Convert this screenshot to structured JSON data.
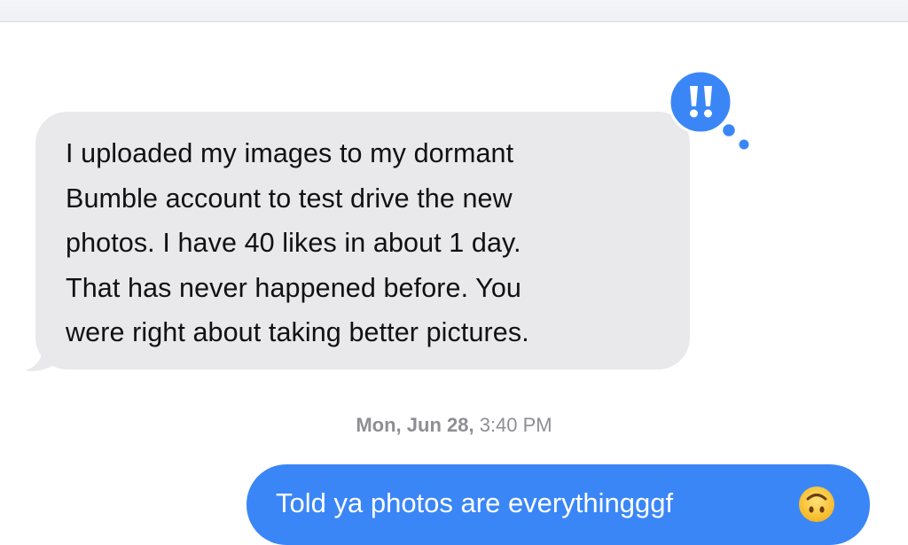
{
  "conversation": {
    "received_message": {
      "lines": [
        "I uploaded my images to my dormant",
        "Bumble account to test drive the new",
        "photos. I have 40 likes in about 1 day.",
        "That has never happened before. You",
        "were right about taking better pictures."
      ],
      "reaction": "exclamation-tapback-icon"
    },
    "timestamp": {
      "day": "Mon, Jun 28,",
      "time": " 3:40 PM"
    },
    "sent_message": {
      "text": "Told ya photos are everythingggf",
      "emoji": "upside-down-face-icon"
    }
  },
  "colors": {
    "received_bubble": "#e9e9eb",
    "sent_bubble": "#3a86f7",
    "tapback": "#3a86f7",
    "timestamp": "#8e8e93"
  }
}
